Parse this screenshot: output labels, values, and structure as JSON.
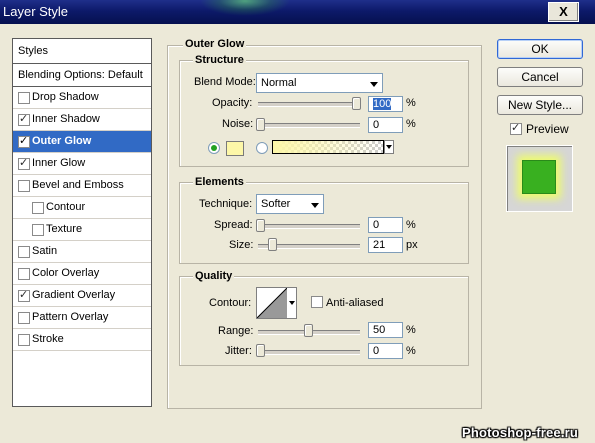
{
  "window": {
    "title": "Layer Style",
    "close_label": "X"
  },
  "styles_panel": {
    "header": "Styles",
    "blending": "Blending Options: Default",
    "items": [
      {
        "label": "Drop Shadow",
        "checked": false,
        "selected": false,
        "indent": false
      },
      {
        "label": "Inner Shadow",
        "checked": true,
        "selected": false,
        "indent": false
      },
      {
        "label": "Outer Glow",
        "checked": true,
        "selected": true,
        "indent": false
      },
      {
        "label": "Inner Glow",
        "checked": true,
        "selected": false,
        "indent": false
      },
      {
        "label": "Bevel and Emboss",
        "checked": false,
        "selected": false,
        "indent": false
      },
      {
        "label": "Contour",
        "checked": false,
        "selected": false,
        "indent": true
      },
      {
        "label": "Texture",
        "checked": false,
        "selected": false,
        "indent": true
      },
      {
        "label": "Satin",
        "checked": false,
        "selected": false,
        "indent": false
      },
      {
        "label": "Color Overlay",
        "checked": false,
        "selected": false,
        "indent": false
      },
      {
        "label": "Gradient Overlay",
        "checked": true,
        "selected": false,
        "indent": false
      },
      {
        "label": "Pattern Overlay",
        "checked": false,
        "selected": false,
        "indent": false
      },
      {
        "label": "Stroke",
        "checked": false,
        "selected": false,
        "indent": false
      }
    ]
  },
  "outer_glow": {
    "title": "Outer Glow",
    "structure": {
      "title": "Structure",
      "blend_mode_label": "Blend Mode:",
      "blend_mode_value": "Normal",
      "opacity_label": "Opacity:",
      "opacity_value": "100",
      "opacity_unit": "%",
      "noise_label": "Noise:",
      "noise_value": "0",
      "noise_unit": "%",
      "color_swatch": "#fdf7a8",
      "gradient_from": "#fdf7a8"
    },
    "elements": {
      "title": "Elements",
      "technique_label": "Technique:",
      "technique_value": "Softer",
      "spread_label": "Spread:",
      "spread_value": "0",
      "spread_unit": "%",
      "size_label": "Size:",
      "size_value": "21",
      "size_unit": "px"
    },
    "quality": {
      "title": "Quality",
      "contour_label": "Contour:",
      "anti_aliased_label": "Anti-aliased",
      "anti_aliased_checked": false,
      "range_label": "Range:",
      "range_value": "50",
      "range_unit": "%",
      "jitter_label": "Jitter:",
      "jitter_value": "0",
      "jitter_unit": "%"
    }
  },
  "buttons": {
    "ok": "OK",
    "cancel": "Cancel",
    "new_style": "New Style..."
  },
  "preview": {
    "label": "Preview",
    "checked": true
  },
  "watermark": "Photoshop-free.ru"
}
